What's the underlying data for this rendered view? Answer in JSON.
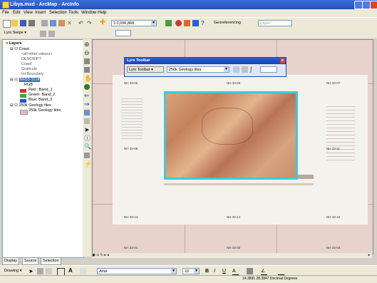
{
  "window": {
    "title": "Libya.mxd - ArcMap - ArcInfo"
  },
  "menubar": [
    "File",
    "Edit",
    "View",
    "Insert",
    "Selection",
    "Tools",
    "Window",
    "Help"
  ],
  "toolbar": {
    "scale": "1:2,096,868",
    "georeferencing_label": "Georeferencing",
    "layer_combo": "Layer:"
  },
  "swipe": {
    "label": "Lyrs Swipe"
  },
  "toc": {
    "root": "Layers",
    "items": [
      {
        "label": "Coast",
        "level": 1,
        "checked": true
      },
      {
        "label": "<all other values>",
        "level": 2
      },
      {
        "label": "DESCRIPT",
        "level": 2
      },
      {
        "label": "Coast",
        "level": 2
      },
      {
        "label": "Graticule",
        "level": 2
      },
      {
        "label": "Int Boundary",
        "level": 2
      },
      {
        "label": "NH33-10.tif",
        "level": 1,
        "checked": true,
        "selected": true
      },
      {
        "label": "RGB",
        "level": 2
      },
      {
        "label": "Red : Band_1",
        "level": 2,
        "swatch": "#d2302c"
      },
      {
        "label": "Green: Band_2",
        "level": 2,
        "swatch": "#3aa63a"
      },
      {
        "label": "Blue: Band_3",
        "level": 2,
        "swatch": "#2c4fc8"
      },
      {
        "label": "250k Geology tiles",
        "level": 1,
        "checked": true
      },
      {
        "label": "250k Geology tiles",
        "level": 2,
        "swatch": "#e8b8b8"
      }
    ],
    "tabs": [
      "Display",
      "Source",
      "Selection"
    ]
  },
  "swipe_toolbar": {
    "title": "Lyrs Toolbar",
    "button": "Lyrs Toolbar",
    "layer": "250k Geology tiles"
  },
  "map": {
    "grid_labels": [
      "NH 33-05",
      "NH 33-06",
      "NH 33-07",
      "NH 33-09",
      "NH 33-11",
      "NH 33-13",
      "NH 33-14",
      "NH 33-15",
      "NH 33-01",
      "NH 33-02",
      "NH 33-03"
    ]
  },
  "drawbar": {
    "drawing": "Drawing",
    "font": "Arial",
    "size": "10"
  },
  "status": {
    "coords": "14.3891 28.3847 Decimal Degrees"
  },
  "colors": {
    "raster_border": "#3fc8d8",
    "title_bar": "#2350b8"
  }
}
